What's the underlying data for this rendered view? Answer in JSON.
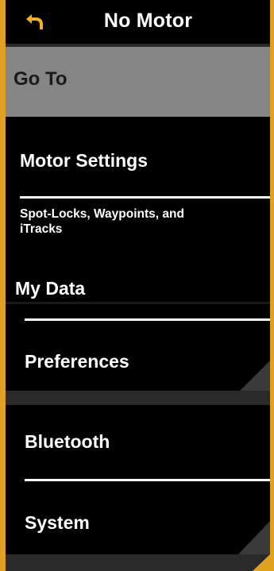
{
  "header": {
    "title": "No Motor",
    "back_icon": "back-arrow-icon"
  },
  "menu": {
    "goto_label": "Go To",
    "motor_settings_label": "Motor Settings",
    "spotlocks_label_line1": "Spot-Locks, Waypoints, and",
    "spotlocks_label_line2": "iTracks",
    "my_data_label": "My Data",
    "preferences_label": "Preferences",
    "bluetooth_label": "Bluetooth",
    "system_label": "System"
  },
  "colors": {
    "accent": "#e0a020",
    "selected_bg": "#858585",
    "background": "#000000",
    "text": "#ffffff"
  }
}
